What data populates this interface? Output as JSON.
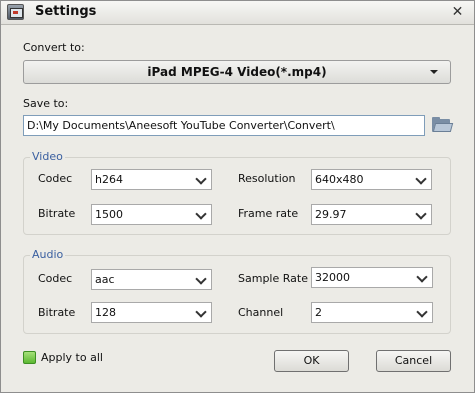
{
  "window": {
    "title": "Settings",
    "close_glyph": "✕"
  },
  "convert": {
    "label": "Convert to:",
    "value": "iPad MPEG-4 Video(*.mp4)"
  },
  "save": {
    "label": "Save to:",
    "path": "D:\\My Documents\\Aneesoft YouTube Converter\\Convert\\"
  },
  "video": {
    "title": "Video",
    "codec_label": "Codec",
    "codec_value": "h264",
    "bitrate_label": "Bitrate",
    "bitrate_value": "1500",
    "resolution_label": "Resolution",
    "resolution_value": "640x480",
    "framerate_label": "Frame rate",
    "framerate_value": "29.97"
  },
  "audio": {
    "title": "Audio",
    "codec_label": "Codec",
    "codec_value": "aac",
    "bitrate_label": "Bitrate",
    "bitrate_value": "128",
    "samplerate_label": "Sample Rate",
    "samplerate_value": "32000",
    "channel_label": "Channel",
    "channel_value": "2"
  },
  "apply_all": {
    "label": "Apply to all",
    "checked": true
  },
  "buttons": {
    "ok": "OK",
    "cancel": "Cancel"
  },
  "icons": {
    "app": "app-icon",
    "close": "close-icon",
    "folder": "folder-icon",
    "dropdown": "chevron-down-icon"
  },
  "colors": {
    "group_title": "#3a5fa0",
    "checkbox": "#5cb832",
    "window_bg": "#ecebe6"
  }
}
